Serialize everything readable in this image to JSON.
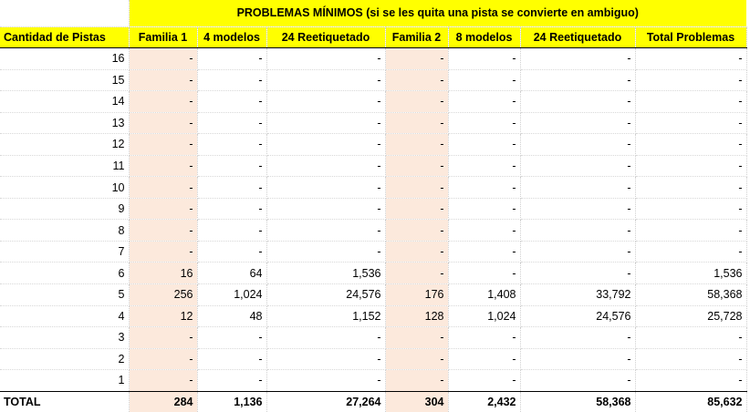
{
  "title": "PROBLEMAS MÍNIMOS (si se les quita una pista se convierte en ambiguo)",
  "headers": {
    "pistas": "Cantidad de Pistas",
    "f1": "Familia 1",
    "f1_models": "4 modelos",
    "f1_relabel": "24 Reetiquetado",
    "f2": "Familia 2",
    "f2_models": "8 modelos",
    "f2_relabel": "24 Reetiquetado",
    "total": "Total Problemas"
  },
  "rows": [
    {
      "pistas": "16",
      "f1": "-",
      "f1_models": "-",
      "f1_relabel": "-",
      "f2": "-",
      "f2_models": "-",
      "f2_relabel": "-",
      "total": "-"
    },
    {
      "pistas": "15",
      "f1": "-",
      "f1_models": "-",
      "f1_relabel": "-",
      "f2": "-",
      "f2_models": "-",
      "f2_relabel": "-",
      "total": "-"
    },
    {
      "pistas": "14",
      "f1": "-",
      "f1_models": "-",
      "f1_relabel": "-",
      "f2": "-",
      "f2_models": "-",
      "f2_relabel": "-",
      "total": "-"
    },
    {
      "pistas": "13",
      "f1": "-",
      "f1_models": "-",
      "f1_relabel": "-",
      "f2": "-",
      "f2_models": "-",
      "f2_relabel": "-",
      "total": "-"
    },
    {
      "pistas": "12",
      "f1": "-",
      "f1_models": "-",
      "f1_relabel": "-",
      "f2": "-",
      "f2_models": "-",
      "f2_relabel": "-",
      "total": "-"
    },
    {
      "pistas": "11",
      "f1": "-",
      "f1_models": "-",
      "f1_relabel": "-",
      "f2": "-",
      "f2_models": "-",
      "f2_relabel": "-",
      "total": "-"
    },
    {
      "pistas": "10",
      "f1": "-",
      "f1_models": "-",
      "f1_relabel": "-",
      "f2": "-",
      "f2_models": "-",
      "f2_relabel": "-",
      "total": "-"
    },
    {
      "pistas": "9",
      "f1": "-",
      "f1_models": "-",
      "f1_relabel": "-",
      "f2": "-",
      "f2_models": "-",
      "f2_relabel": "-",
      "total": "-"
    },
    {
      "pistas": "8",
      "f1": "-",
      "f1_models": "-",
      "f1_relabel": "-",
      "f2": "-",
      "f2_models": "-",
      "f2_relabel": "-",
      "total": "-"
    },
    {
      "pistas": "7",
      "f1": "-",
      "f1_models": "-",
      "f1_relabel": "-",
      "f2": "-",
      "f2_models": "-",
      "f2_relabel": "-",
      "total": "-"
    },
    {
      "pistas": "6",
      "f1": "16",
      "f1_models": "64",
      "f1_relabel": "1,536",
      "f2": "-",
      "f2_models": "-",
      "f2_relabel": "-",
      "total": "1,536"
    },
    {
      "pistas": "5",
      "f1": "256",
      "f1_models": "1,024",
      "f1_relabel": "24,576",
      "f2": "176",
      "f2_models": "1,408",
      "f2_relabel": "33,792",
      "total": "58,368"
    },
    {
      "pistas": "4",
      "f1": "12",
      "f1_models": "48",
      "f1_relabel": "1,152",
      "f2": "128",
      "f2_models": "1,024",
      "f2_relabel": "24,576",
      "total": "25,728"
    },
    {
      "pistas": "3",
      "f1": "-",
      "f1_models": "-",
      "f1_relabel": "-",
      "f2": "-",
      "f2_models": "-",
      "f2_relabel": "-",
      "total": "-"
    },
    {
      "pistas": "2",
      "f1": "-",
      "f1_models": "-",
      "f1_relabel": "-",
      "f2": "-",
      "f2_models": "-",
      "f2_relabel": "-",
      "total": "-"
    },
    {
      "pistas": "1",
      "f1": "-",
      "f1_models": "-",
      "f1_relabel": "-",
      "f2": "-",
      "f2_models": "-",
      "f2_relabel": "-",
      "total": "-"
    }
  ],
  "total_row": {
    "label": "TOTAL",
    "f1": "284",
    "f1_models": "1,136",
    "f1_relabel": "27,264",
    "f2": "304",
    "f2_models": "2,432",
    "f2_relabel": "58,368",
    "total": "85,632"
  },
  "colors": {
    "header_fill": "#ffff00",
    "family_column_fill": "#fce9dc"
  }
}
